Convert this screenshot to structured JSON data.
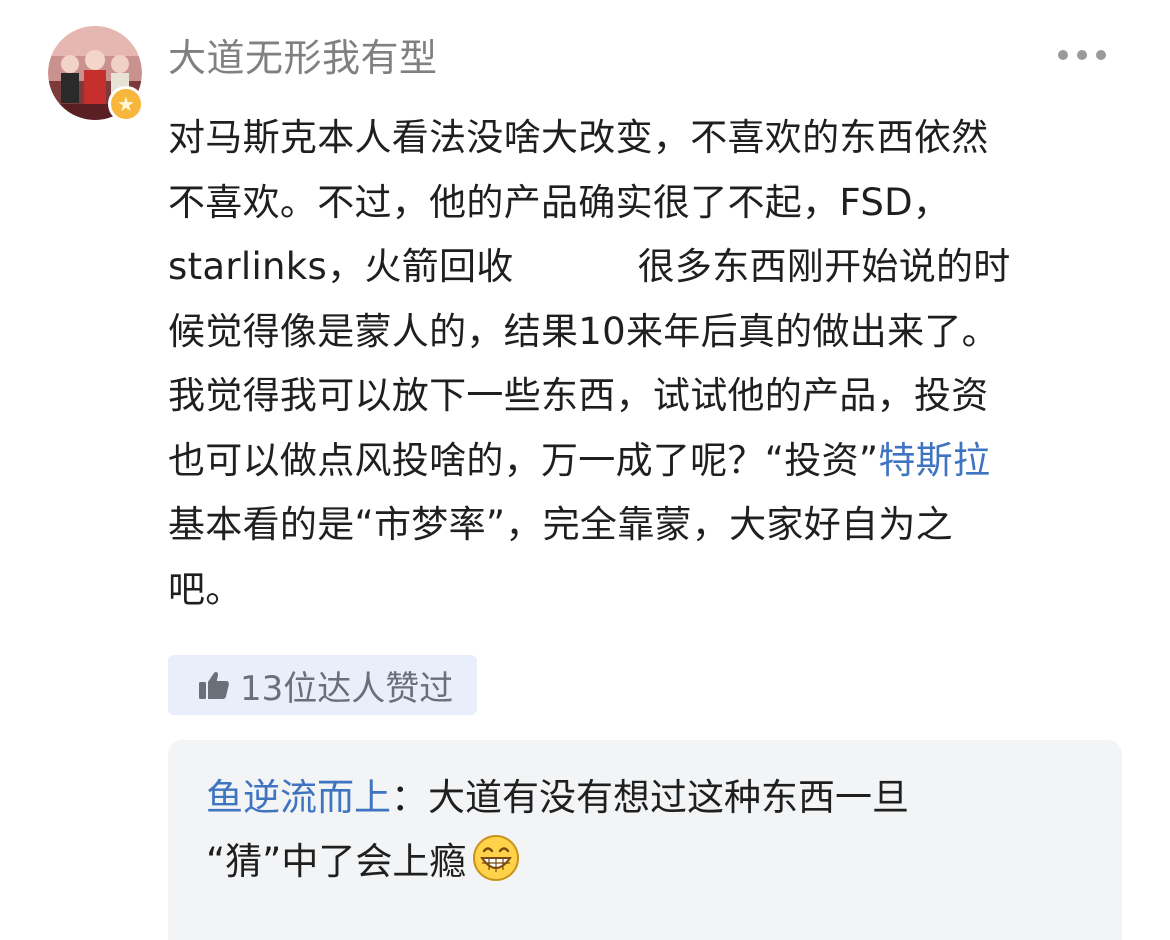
{
  "post": {
    "username": "大道无形我有型",
    "avatar_icon": "user-avatar",
    "badge_icon": "star-badge-icon",
    "more_icon": "more-dots-icon",
    "content_lines": [
      "对马斯克本人看法没啥大改变，不喜欢的东西依然",
      "不喜欢。不过，他的产品确实很了不起，FSD，",
      "starlinks，火箭回收",
      "很多东西刚开始说的时",
      "候觉得像是蒙人的，结果10来年后真的做出来了。",
      "我觉得我可以放下一些东西，试试他的产品，投资",
      "也可以做点风投啥的，万一成了呢？“投资”",
      "特斯拉",
      "基本看的是“市梦率”，完全靠蒙，大家好自为之",
      "吧。"
    ],
    "link_color": "#3f74c1"
  },
  "likes": {
    "icon": "thumbs-up-icon",
    "label": "13位达人赞过"
  },
  "reply": {
    "author": "鱼逆流而上",
    "separator": "：",
    "line1": "大道有没有想过这种东西一旦",
    "line2": "“猜”中了会上瘾",
    "emoji_icon": "grinning-face-icon"
  }
}
